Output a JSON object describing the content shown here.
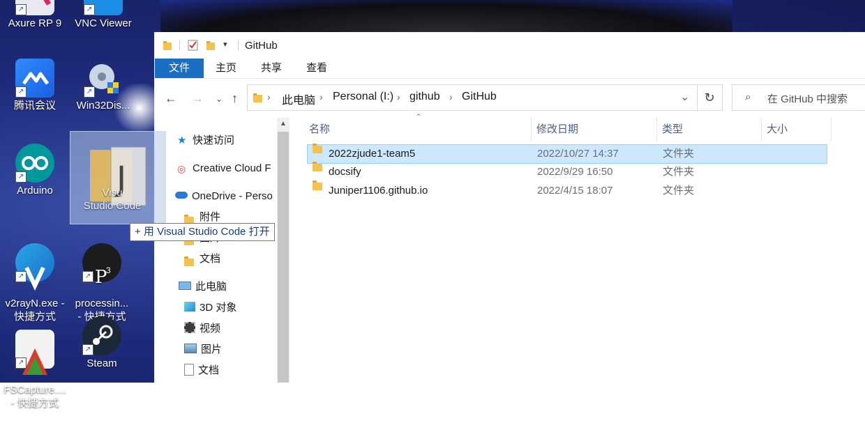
{
  "desktop": {
    "icons": [
      {
        "label": "Axure RP 9"
      },
      {
        "label": "VNC Viewer"
      },
      {
        "label": "腾讯会议"
      },
      {
        "label": "Win32Dis..."
      },
      {
        "label": "Arduino"
      },
      {
        "label": "v2rayN.exe -\n快捷方式"
      },
      {
        "label": "processin...\n- 快捷方式"
      },
      {
        "label": "FSCapture....\n- 快捷方式"
      },
      {
        "label": "Steam"
      }
    ],
    "drag_label": "Visu\nStudio Code"
  },
  "explorer": {
    "title": "GitHub",
    "ribbon_tabs": [
      "文件",
      "主页",
      "共享",
      "查看"
    ],
    "breadcrumb": [
      "此电脑",
      "Personal (I:)",
      "github",
      "GitHub"
    ],
    "search_placeholder": "在 GitHub 中搜索",
    "nav_items": [
      {
        "label": "快速访问",
        "icon": "star-icon"
      },
      {
        "label": "Creative Cloud F",
        "icon": "creative-cloud-icon"
      },
      {
        "label": "OneDrive - Perso",
        "icon": "onedrive-icon"
      },
      {
        "label": "附件",
        "icon": "folder-icon"
      },
      {
        "label": "图片",
        "icon": "folder-icon"
      },
      {
        "label": "文档",
        "icon": "folder-icon"
      },
      {
        "label": "此电脑",
        "icon": "computer-icon"
      },
      {
        "label": "3D 对象",
        "icon": "3d-objects-icon"
      },
      {
        "label": "视频",
        "icon": "video-icon"
      },
      {
        "label": "图片",
        "icon": "pictures-icon"
      },
      {
        "label": "文档",
        "icon": "documents-icon"
      }
    ],
    "columns": [
      "名称",
      "修改日期",
      "类型",
      "大小"
    ],
    "files": [
      {
        "name": "2022zjude1-team5",
        "date": "2022/10/27 14:37",
        "type": "文件夹",
        "selected": true
      },
      {
        "name": "docsify",
        "date": "2022/9/29 16:50",
        "type": "文件夹",
        "selected": false
      },
      {
        "name": "Juniper1106.github.io",
        "date": "2022/4/15 18:07",
        "type": "文件夹",
        "selected": false
      }
    ]
  },
  "drag_tooltip": "+ 用 Visual Studio Code 打开"
}
